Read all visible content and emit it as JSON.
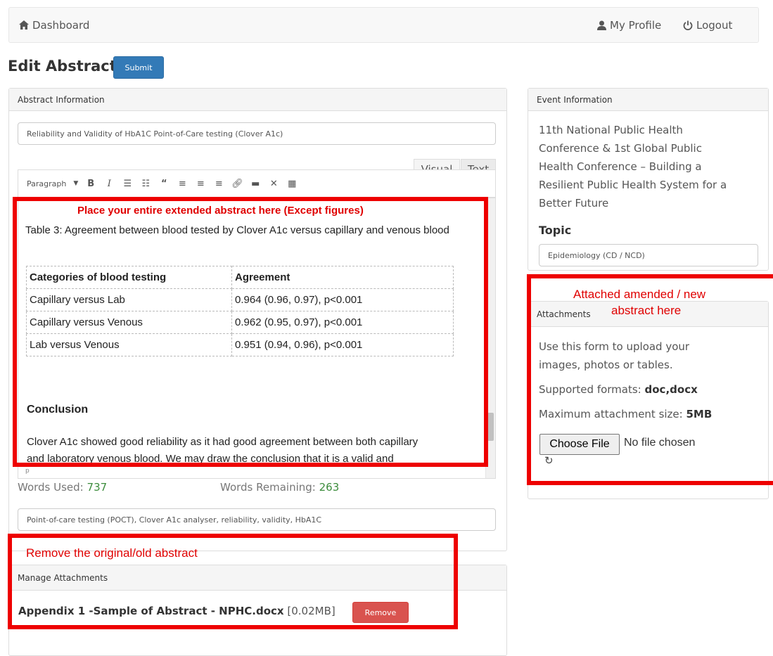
{
  "navbar": {
    "dashboard_label": "Dashboard",
    "profile_label": "My Profile",
    "logout_label": "Logout"
  },
  "page": {
    "title": "Edit Abstract",
    "submit_label": "Submit"
  },
  "abstract_panel": {
    "heading": "Abstract Information",
    "title_value": "Reliability and Validity of HbA1C Point-of-Care testing (Clover A1c)",
    "tabs": [
      "Visual",
      "Text"
    ],
    "toolbar": {
      "format_select": "Paragraph",
      "icons": [
        "bold-icon",
        "italic-icon",
        "bullet-list-icon",
        "numbered-list-icon",
        "blockquote-icon",
        "align-left-icon",
        "align-center-icon",
        "align-right-icon",
        "link-icon",
        "read-more-icon",
        "fullscreen-icon",
        "toolbar-toggle-icon"
      ]
    },
    "editor": {
      "table_caption": "Table 3: Agreement between blood tested by Clover A1c versus capillary and venous blood",
      "table_headers": [
        "Categories of blood testing",
        "Agreement"
      ],
      "table_rows": [
        [
          "Capillary versus Lab",
          "0.964 (0.96, 0.97), p<0.001"
        ],
        [
          "Capillary versus Venous",
          "0.962 (0.95, 0.97), p<0.001"
        ],
        [
          "Lab versus Venous",
          "0.951 (0.94, 0.96), p<0.001"
        ]
      ],
      "conclusion_heading": "Conclusion",
      "conclusion_text_line1": "Clover A1c showed good reliability as it had good agreement between both capillary",
      "conclusion_text_line2": "and laboratory venous blood. We may draw the conclusion that it is a valid and",
      "path_indicator": "p"
    },
    "words_used_label": "Words Used:",
    "words_used_value": "737",
    "words_remaining_label": "Words Remaining:",
    "words_remaining_value": "263",
    "keywords_value": "Point-of-care testing (POCT), Clover A1c analyser, reliability, validity, HbA1C"
  },
  "manage_attachments": {
    "heading": "Manage Attachments",
    "file_name": "Appendix 1 -Sample of Abstract - NPHC.docx",
    "file_size": "[0.02MB]",
    "remove_label": "Remove"
  },
  "event_panel": {
    "heading": "Event Information",
    "event_name_lines": [
      "11th National Public Health",
      "Conference & 1st Global Public",
      "Health Conference – Building a",
      "Resilient Public Health System for a",
      "Better Future"
    ],
    "topic_label": "Topic",
    "topic_value": "Epidemiology (CD / NCD)"
  },
  "attachments_panel": {
    "heading": "Attachments",
    "upload_text_line1": "Use this form to upload your",
    "upload_text_line2": "images, photos or tables.",
    "formats_label": "Supported formats:",
    "formats_value": "doc,docx",
    "max_size_label": "Maximum attachment size:",
    "max_size_value": "5MB",
    "choose_file_label": "Choose File",
    "no_file_label": "No file chosen"
  },
  "annotations": {
    "editor_note": "Place your entire extended abstract here (Except figures)",
    "attach_note_line1": "Attached amended / new",
    "attach_note_line2": "abstract here",
    "remove_note": "Remove the original/old abstract"
  },
  "colors": {
    "annotation_red": "#ee0000",
    "primary_blue": "#337ab7",
    "danger_red": "#d9534f",
    "word_count_green": "#3c8c3c"
  }
}
